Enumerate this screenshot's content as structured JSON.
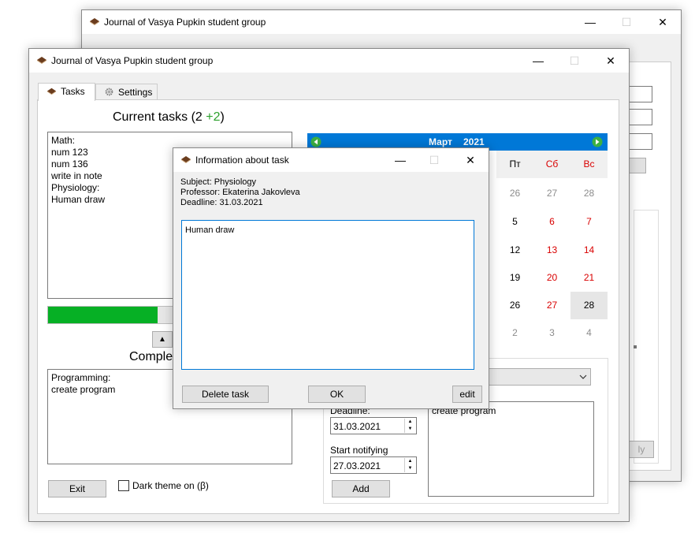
{
  "back_window": {
    "title": "Journal of Vasya Pupkin student group",
    "btn_label": "ly"
  },
  "main_window": {
    "title": "Journal of Vasya Pupkin student group",
    "tabs": [
      {
        "label": "Tasks"
      },
      {
        "label": "Settings"
      }
    ],
    "current_tasks": {
      "label": "Current tasks",
      "count_open": " (2 ",
      "count_added": "+2",
      "count_close": ")"
    },
    "task_list": "Math:\nnum 123\nnum 136\nwrite in note\nPhysiology:\nHuman draw",
    "progress_fraction": 0.45,
    "collapse_arrow": "▲",
    "completed_label": "Complet",
    "completed_list": "Programming:\ncreate program",
    "exit_label": "Exit",
    "dark_theme_label": "Dark theme on (β)",
    "calendar": {
      "month": "Март",
      "year": "2021",
      "weekdays": [
        "Пт",
        "Сб",
        "Вс"
      ],
      "rows": [
        [
          "26",
          "27",
          "28"
        ],
        [
          "5",
          "6",
          "7"
        ],
        [
          "12",
          "13",
          "14"
        ],
        [
          "19",
          "20",
          "21"
        ],
        [
          "26",
          "27",
          "28"
        ],
        [
          "2",
          "3",
          "4"
        ]
      ]
    },
    "deadline_label": "Deadline:",
    "deadline_value": "31.03.2021",
    "start_label": "Start notifying",
    "start_value": "27.03.2021",
    "add_label": "Add",
    "task_text_value": "create program"
  },
  "dialog": {
    "title": "Information about task",
    "subject": "Subject: Physiology",
    "professor": "Professor: Ekaterina Jakovleva",
    "deadline": "Deadline: 31.03.2021",
    "description": "Human draw",
    "delete_label": "Delete task",
    "ok_label": "OK",
    "edit_label": "edit"
  },
  "colors": {
    "accent": "#0078d7",
    "progress": "#06b025",
    "green_text": "#2ca02c",
    "weekend": "#d90000"
  }
}
